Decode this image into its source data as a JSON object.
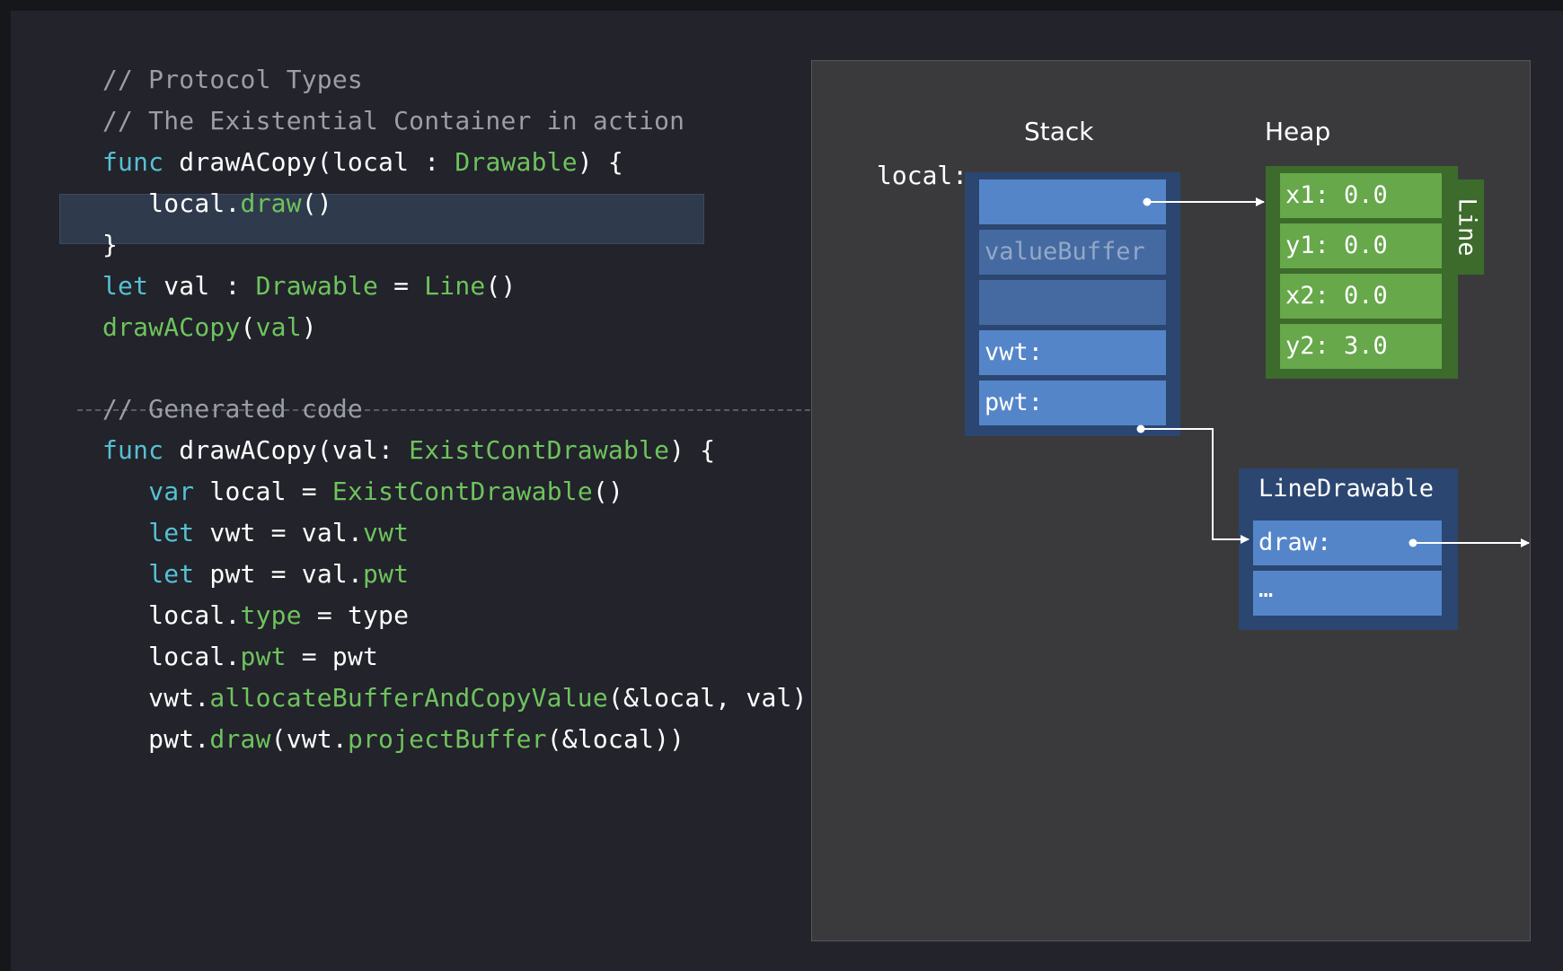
{
  "code": {
    "top": [
      [
        {
          "t": "// Protocol Types",
          "c": "cm"
        }
      ],
      [
        {
          "t": "// The Existential Container in action",
          "c": "cm"
        }
      ],
      [
        {
          "t": "func",
          "c": "kw"
        },
        {
          "t": " drawACopy(local : ",
          "c": "pl"
        },
        {
          "t": "Drawable",
          "c": "ty"
        },
        {
          "t": ") {",
          "c": "pl"
        }
      ],
      [
        {
          "t": "   local.",
          "c": "pl"
        },
        {
          "t": "draw",
          "c": "ty"
        },
        {
          "t": "()",
          "c": "pl"
        }
      ],
      [
        {
          "t": "}",
          "c": "pl"
        }
      ],
      [
        {
          "t": "let",
          "c": "kw"
        },
        {
          "t": " val : ",
          "c": "pl"
        },
        {
          "t": "Drawable",
          "c": "ty"
        },
        {
          "t": " = ",
          "c": "pl"
        },
        {
          "t": "Line",
          "c": "ty"
        },
        {
          "t": "()",
          "c": "pl"
        }
      ],
      [
        {
          "t": "drawACopy",
          "c": "ty"
        },
        {
          "t": "(",
          "c": "pl"
        },
        {
          "t": "val",
          "c": "ty"
        },
        {
          "t": ")",
          "c": "pl"
        }
      ]
    ],
    "bottom": [
      [
        {
          "t": "// Generated code",
          "c": "cm"
        }
      ],
      [
        {
          "t": "func",
          "c": "kw"
        },
        {
          "t": " drawACopy(val: ",
          "c": "pl"
        },
        {
          "t": "ExistContDrawable",
          "c": "ty"
        },
        {
          "t": ") {",
          "c": "pl"
        }
      ],
      [
        {
          "t": "   ",
          "c": "pl"
        },
        {
          "t": "var",
          "c": "kw"
        },
        {
          "t": " local = ",
          "c": "pl"
        },
        {
          "t": "ExistContDrawable",
          "c": "ty"
        },
        {
          "t": "()",
          "c": "pl"
        }
      ],
      [
        {
          "t": "   ",
          "c": "pl"
        },
        {
          "t": "let",
          "c": "kw"
        },
        {
          "t": " vwt = val.",
          "c": "pl"
        },
        {
          "t": "vwt",
          "c": "ty"
        }
      ],
      [
        {
          "t": "   ",
          "c": "pl"
        },
        {
          "t": "let",
          "c": "kw"
        },
        {
          "t": " pwt = val.",
          "c": "pl"
        },
        {
          "t": "pwt",
          "c": "ty"
        }
      ],
      [
        {
          "t": "   local.",
          "c": "pl"
        },
        {
          "t": "type",
          "c": "ty"
        },
        {
          "t": " = type",
          "c": "pl"
        }
      ],
      [
        {
          "t": "   local.",
          "c": "pl"
        },
        {
          "t": "pwt",
          "c": "ty"
        },
        {
          "t": " = pwt",
          "c": "pl"
        }
      ],
      [
        {
          "t": "   vwt.",
          "c": "pl"
        },
        {
          "t": "allocateBufferAndCopyValue",
          "c": "ty"
        },
        {
          "t": "(&local, val)",
          "c": "pl"
        }
      ],
      [
        {
          "t": "   pwt.",
          "c": "pl"
        },
        {
          "t": "draw",
          "c": "ty"
        },
        {
          "t": "(vwt.",
          "c": "pl"
        },
        {
          "t": "projectBuffer",
          "c": "ty"
        },
        {
          "t": "(&local))",
          "c": "pl"
        }
      ]
    ],
    "highlighted_line": 3
  },
  "diagram": {
    "stack_title": "Stack",
    "heap_title": "Heap",
    "local_label": "local:",
    "stack_cells": [
      "",
      "valueBuffer",
      "",
      "vwt:",
      "pwt:"
    ],
    "heap_cells": [
      "x1: 0.0",
      "y1: 0.0",
      "x2: 0.0",
      "y2: 3.0"
    ],
    "heap_side_label": "Line",
    "pwt_table_title": "LineDrawable",
    "pwt_cells": [
      "draw:",
      "…"
    ]
  },
  "colors": {
    "comment": "#9b9ea4",
    "keyword": "#55c1d3",
    "type": "#6fc35d",
    "cell_blue": "#5585c9",
    "cell_blue_dim": "#456aa1",
    "container_blue": "#2b4670",
    "heap_green": "#66a84a",
    "heap_container": "#3c6b2c"
  }
}
